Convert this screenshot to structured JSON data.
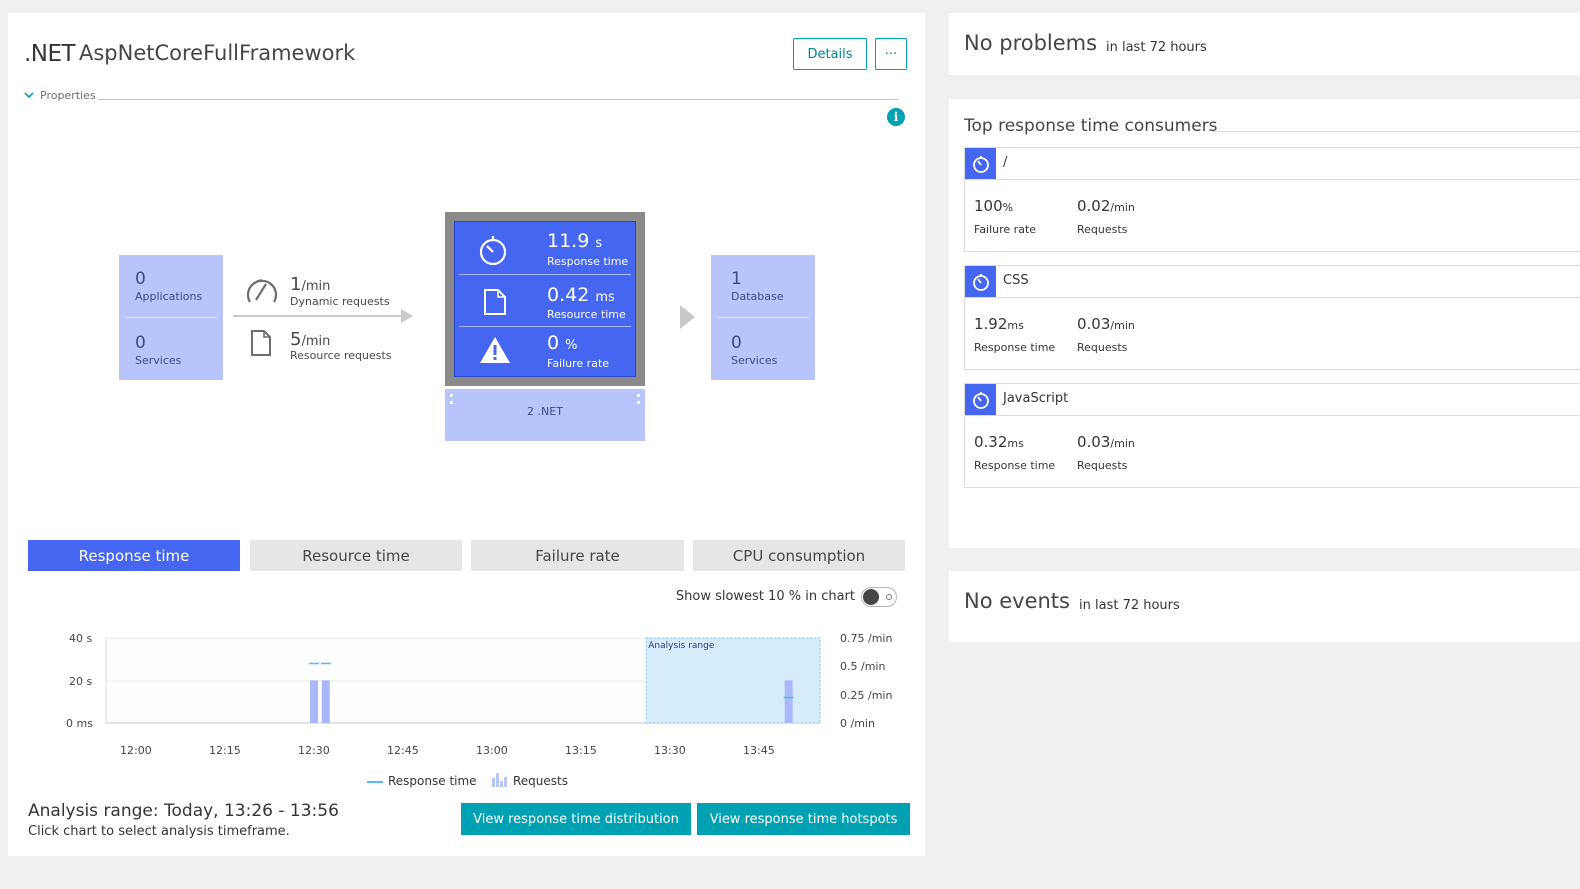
{
  "main": {
    "tech": ".NET",
    "name": "AspNetCoreFullFramework",
    "details_label": "Details",
    "more_label": "···",
    "properties_label": "Properties",
    "info_label": "i"
  },
  "flow": {
    "left": {
      "applications_value": "0",
      "applications_label": "Applications",
      "services_value": "0",
      "services_label": "Services"
    },
    "requests": {
      "dynamic_value": "1",
      "dynamic_unit": "/min",
      "dynamic_label": "Dynamic requests",
      "resource_value": "5",
      "resource_unit": "/min",
      "resource_label": "Resource requests"
    },
    "core": {
      "response_value": "11.9",
      "response_unit": "s",
      "response_label": "Response time",
      "resource_value": "0.42",
      "resource_unit": "ms",
      "resource_label": "Resource time",
      "failure_value": "0",
      "failure_unit": "%",
      "failure_label": "Failure rate",
      "instance_label": "2 .NET"
    },
    "right": {
      "database_value": "1",
      "database_label": "Database",
      "services_value": "0",
      "services_label": "Services"
    }
  },
  "tabs": [
    {
      "label": "Response time",
      "active": true
    },
    {
      "label": "Resource time",
      "active": false
    },
    {
      "label": "Failure rate",
      "active": false
    },
    {
      "label": "CPU consumption",
      "active": false
    }
  ],
  "toggle_label": "Show slowest 10 % in chart",
  "chart_data": {
    "type": "bar",
    "x_ticks": [
      "12:00",
      "12:15",
      "12:30",
      "12:45",
      "13:00",
      "13:15",
      "13:30",
      "13:45"
    ],
    "y_left_ticks": [
      "0 ms",
      "20 s",
      "40 s"
    ],
    "y_right_ticks": [
      "0 /min",
      "0.25 /min",
      "0.5 /min",
      "0.75 /min"
    ],
    "y_left_range": [
      0,
      40
    ],
    "y_right_range": [
      0,
      0.75
    ],
    "analysis_range_label": "Analysis range",
    "analysis_range": [
      "13:26",
      "13:56"
    ],
    "series": [
      {
        "name": "Response time",
        "type": "line",
        "points": [
          {
            "t": "12:30",
            "y": 28
          },
          {
            "t": "12:32",
            "y": 28
          },
          {
            "t": "13:50",
            "y": 12
          }
        ]
      },
      {
        "name": "Requests",
        "type": "bar",
        "points": [
          {
            "t": "12:30",
            "y": 0.5
          },
          {
            "t": "12:32",
            "y": 0.5
          },
          {
            "t": "13:50",
            "y": 0.5
          }
        ]
      }
    ],
    "legend": [
      "Response time",
      "Requests"
    ],
    "legend_position": "bottom"
  },
  "analysis": {
    "title": "Analysis range: Today, 13:26 - 13:56",
    "subtitle": "Click chart to select analysis timeframe.",
    "btn_distribution": "View response time distribution",
    "btn_hotspots": "View response time hotspots"
  },
  "problems": {
    "title": "No problems",
    "sub": "in last 72 hours"
  },
  "consumers": {
    "title": "Top response time consumers",
    "items": [
      {
        "name": "/",
        "m1_value": "100",
        "m1_unit": "%",
        "m1_label": "Failure rate",
        "m2_value": "0.02",
        "m2_unit": "/min",
        "m2_label": "Requests"
      },
      {
        "name": "CSS",
        "m1_value": "1.92",
        "m1_unit": "ms",
        "m1_label": "Response time",
        "m2_value": "0.03",
        "m2_unit": "/min",
        "m2_label": "Requests"
      },
      {
        "name": "JavaScript",
        "m1_value": "0.32",
        "m1_unit": "ms",
        "m1_label": "Response time",
        "m2_value": "0.03",
        "m2_unit": "/min",
        "m2_label": "Requests"
      }
    ]
  },
  "events": {
    "title": "No events",
    "sub": "in last 72 hours"
  },
  "colors": {
    "accent": "#4566f0",
    "teal": "#00a1b2",
    "light": "#b8c4fc",
    "analysis": "#d5ecfb"
  }
}
